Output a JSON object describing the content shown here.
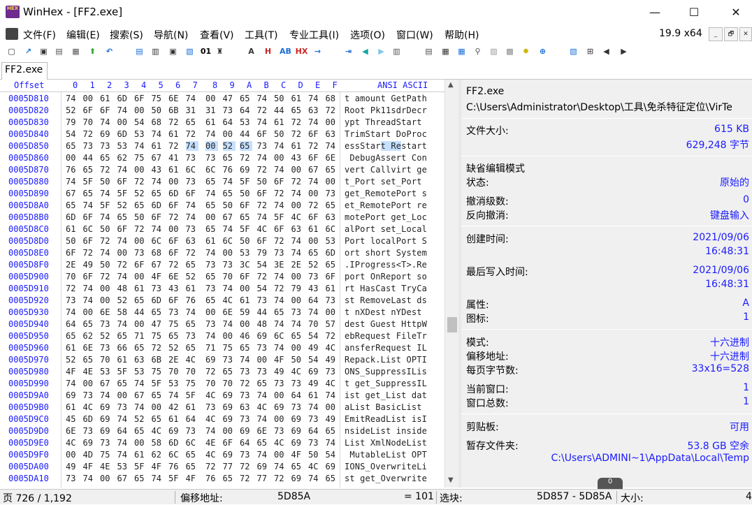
{
  "window": {
    "title": "WinHex - [FF2.exe]",
    "logo_text": "HEX",
    "minimize": "—",
    "maximize": "☐",
    "close": "✕"
  },
  "menu": {
    "items": [
      "文件(F)",
      "编辑(E)",
      "搜索(S)",
      "导航(N)",
      "查看(V)",
      "工具(T)",
      "专业工具(I)",
      "选项(O)",
      "窗口(W)",
      "帮助(H)"
    ],
    "version": "19.9 x64",
    "mdi": [
      "_",
      "🗗",
      "✕"
    ]
  },
  "toolbar": {
    "icons": [
      "new-file-icon",
      "open-icon",
      "save-icon",
      "print-icon",
      "properties-icon",
      "open-disk-icon",
      "undo-icon",
      "copy-icon",
      "paste-icon",
      "clipboard-icon",
      "copy-hex-icon",
      "binary-icon",
      "find-icon",
      "find-text-icon",
      "find-hex-icon",
      "replace-text-icon",
      "replace-hex-icon",
      "goto-offset-icon",
      "goto-sector-icon",
      "back-icon",
      "forward-icon",
      "disk-editor-icon",
      "ram-editor-icon",
      "hdd-icon",
      "calc-icon",
      "analyze-icon",
      "search-disk-icon",
      "hash-icon",
      "options-icon",
      "unk-icon",
      "sidebar-icon",
      "prev-icon",
      "next-icon",
      "help-book-icon"
    ]
  },
  "tab": {
    "label": "FF2.exe"
  },
  "hex": {
    "header": {
      "offset": "Offset",
      "cols": [
        "0",
        "1",
        "2",
        "3",
        "4",
        "5",
        "6",
        "7",
        "8",
        "9",
        "A",
        "B",
        "C",
        "D",
        "E",
        "F"
      ],
      "ansi": "ANSI ASCII"
    },
    "rows": [
      {
        "off": "0005D810",
        "b": [
          "74",
          "00",
          "61",
          "6D",
          "6F",
          "75",
          "6E",
          "74",
          "00",
          "47",
          "65",
          "74",
          "50",
          "61",
          "74",
          "68"
        ],
        "a": "t amount GetPath"
      },
      {
        "off": "0005D820",
        "b": [
          "52",
          "6F",
          "6F",
          "74",
          "00",
          "50",
          "6B",
          "31",
          "31",
          "73",
          "64",
          "72",
          "44",
          "65",
          "63",
          "72"
        ],
        "a": "Root Pk11sdrDecr"
      },
      {
        "off": "0005D830",
        "b": [
          "79",
          "70",
          "74",
          "00",
          "54",
          "68",
          "72",
          "65",
          "61",
          "64",
          "53",
          "74",
          "61",
          "72",
          "74",
          "00"
        ],
        "a": "ypt ThreadStart "
      },
      {
        "off": "0005D840",
        "b": [
          "54",
          "72",
          "69",
          "6D",
          "53",
          "74",
          "61",
          "72",
          "74",
          "00",
          "44",
          "6F",
          "50",
          "72",
          "6F",
          "63"
        ],
        "a": "TrimStart DoProc"
      },
      {
        "off": "0005D850",
        "b": [
          "65",
          "73",
          "73",
          "53",
          "74",
          "61",
          "72",
          "74",
          "00",
          "52",
          "65",
          "73",
          "74",
          "61",
          "72",
          "74"
        ],
        "a": "essStart Restart"
      },
      {
        "off": "0005D860",
        "b": [
          "00",
          "44",
          "65",
          "62",
          "75",
          "67",
          "41",
          "73",
          "73",
          "65",
          "72",
          "74",
          "00",
          "43",
          "6F",
          "6E"
        ],
        "a": " DebugAssert Con"
      },
      {
        "off": "0005D870",
        "b": [
          "76",
          "65",
          "72",
          "74",
          "00",
          "43",
          "61",
          "6C",
          "6C",
          "76",
          "69",
          "72",
          "74",
          "00",
          "67",
          "65"
        ],
        "a": "vert Callvirt ge"
      },
      {
        "off": "0005D880",
        "b": [
          "74",
          "5F",
          "50",
          "6F",
          "72",
          "74",
          "00",
          "73",
          "65",
          "74",
          "5F",
          "50",
          "6F",
          "72",
          "74",
          "00"
        ],
        "a": "t_Port set_Port "
      },
      {
        "off": "0005D890",
        "b": [
          "67",
          "65",
          "74",
          "5F",
          "52",
          "65",
          "6D",
          "6F",
          "74",
          "65",
          "50",
          "6F",
          "72",
          "74",
          "00",
          "73"
        ],
        "a": "get_RemotePort s"
      },
      {
        "off": "0005D8A0",
        "b": [
          "65",
          "74",
          "5F",
          "52",
          "65",
          "6D",
          "6F",
          "74",
          "65",
          "50",
          "6F",
          "72",
          "74",
          "00",
          "72",
          "65"
        ],
        "a": "et_RemotePort re"
      },
      {
        "off": "0005D8B0",
        "b": [
          "6D",
          "6F",
          "74",
          "65",
          "50",
          "6F",
          "72",
          "74",
          "00",
          "67",
          "65",
          "74",
          "5F",
          "4C",
          "6F",
          "63"
        ],
        "a": "motePort get_Loc"
      },
      {
        "off": "0005D8C0",
        "b": [
          "61",
          "6C",
          "50",
          "6F",
          "72",
          "74",
          "00",
          "73",
          "65",
          "74",
          "5F",
          "4C",
          "6F",
          "63",
          "61",
          "6C"
        ],
        "a": "alPort set_Local"
      },
      {
        "off": "0005D8D0",
        "b": [
          "50",
          "6F",
          "72",
          "74",
          "00",
          "6C",
          "6F",
          "63",
          "61",
          "6C",
          "50",
          "6F",
          "72",
          "74",
          "00",
          "53"
        ],
        "a": "Port localPort S"
      },
      {
        "off": "0005D8E0",
        "b": [
          "6F",
          "72",
          "74",
          "00",
          "73",
          "68",
          "6F",
          "72",
          "74",
          "00",
          "53",
          "79",
          "73",
          "74",
          "65",
          "6D"
        ],
        "a": "ort short System"
      },
      {
        "off": "0005D8F0",
        "b": [
          "2E",
          "49",
          "50",
          "72",
          "6F",
          "67",
          "72",
          "65",
          "73",
          "73",
          "3C",
          "54",
          "3E",
          "2E",
          "52",
          "65"
        ],
        "a": ".IProgress<T>.Re"
      },
      {
        "off": "0005D900",
        "b": [
          "70",
          "6F",
          "72",
          "74",
          "00",
          "4F",
          "6E",
          "52",
          "65",
          "70",
          "6F",
          "72",
          "74",
          "00",
          "73",
          "6F"
        ],
        "a": "port OnReport so"
      },
      {
        "off": "0005D910",
        "b": [
          "72",
          "74",
          "00",
          "48",
          "61",
          "73",
          "43",
          "61",
          "73",
          "74",
          "00",
          "54",
          "72",
          "79",
          "43",
          "61"
        ],
        "a": "rt HasCast TryCa"
      },
      {
        "off": "0005D920",
        "b": [
          "73",
          "74",
          "00",
          "52",
          "65",
          "6D",
          "6F",
          "76",
          "65",
          "4C",
          "61",
          "73",
          "74",
          "00",
          "64",
          "73"
        ],
        "a": "st RemoveLast ds"
      },
      {
        "off": "0005D930",
        "b": [
          "74",
          "00",
          "6E",
          "58",
          "44",
          "65",
          "73",
          "74",
          "00",
          "6E",
          "59",
          "44",
          "65",
          "73",
          "74",
          "00"
        ],
        "a": "t nXDest nYDest "
      },
      {
        "off": "0005D940",
        "b": [
          "64",
          "65",
          "73",
          "74",
          "00",
          "47",
          "75",
          "65",
          "73",
          "74",
          "00",
          "48",
          "74",
          "74",
          "70",
          "57"
        ],
        "a": "dest Guest HttpW"
      },
      {
        "off": "0005D950",
        "b": [
          "65",
          "62",
          "52",
          "65",
          "71",
          "75",
          "65",
          "73",
          "74",
          "00",
          "46",
          "69",
          "6C",
          "65",
          "54",
          "72"
        ],
        "a": "ebRequest FileTr"
      },
      {
        "off": "0005D960",
        "b": [
          "61",
          "6E",
          "73",
          "66",
          "65",
          "72",
          "52",
          "65",
          "71",
          "75",
          "65",
          "73",
          "74",
          "00",
          "49",
          "4C"
        ],
        "a": "ansferRequest IL"
      },
      {
        "off": "0005D970",
        "b": [
          "52",
          "65",
          "70",
          "61",
          "63",
          "6B",
          "2E",
          "4C",
          "69",
          "73",
          "74",
          "00",
          "4F",
          "50",
          "54",
          "49"
        ],
        "a": "Repack.List OPTI"
      },
      {
        "off": "0005D980",
        "b": [
          "4F",
          "4E",
          "53",
          "5F",
          "53",
          "75",
          "70",
          "70",
          "72",
          "65",
          "73",
          "73",
          "49",
          "4C",
          "69",
          "73"
        ],
        "a": "ONS_SuppressILis"
      },
      {
        "off": "0005D990",
        "b": [
          "74",
          "00",
          "67",
          "65",
          "74",
          "5F",
          "53",
          "75",
          "70",
          "70",
          "72",
          "65",
          "73",
          "73",
          "49",
          "4C"
        ],
        "a": "t get_SuppressIL"
      },
      {
        "off": "0005D9A0",
        "b": [
          "69",
          "73",
          "74",
          "00",
          "67",
          "65",
          "74",
          "5F",
          "4C",
          "69",
          "73",
          "74",
          "00",
          "64",
          "61",
          "74"
        ],
        "a": "ist get_List dat"
      },
      {
        "off": "0005D9B0",
        "b": [
          "61",
          "4C",
          "69",
          "73",
          "74",
          "00",
          "42",
          "61",
          "73",
          "69",
          "63",
          "4C",
          "69",
          "73",
          "74",
          "00"
        ],
        "a": "aList BasicList "
      },
      {
        "off": "0005D9C0",
        "b": [
          "45",
          "6D",
          "69",
          "74",
          "52",
          "65",
          "61",
          "64",
          "4C",
          "69",
          "73",
          "74",
          "00",
          "69",
          "73",
          "49"
        ],
        "a": "EmitReadList isI"
      },
      {
        "off": "0005D9D0",
        "b": [
          "6E",
          "73",
          "69",
          "64",
          "65",
          "4C",
          "69",
          "73",
          "74",
          "00",
          "69",
          "6E",
          "73",
          "69",
          "64",
          "65"
        ],
        "a": "nsideList inside"
      },
      {
        "off": "0005D9E0",
        "b": [
          "4C",
          "69",
          "73",
          "74",
          "00",
          "58",
          "6D",
          "6C",
          "4E",
          "6F",
          "64",
          "65",
          "4C",
          "69",
          "73",
          "74"
        ],
        "a": "List XmlNodeList"
      },
      {
        "off": "0005D9F0",
        "b": [
          "00",
          "4D",
          "75",
          "74",
          "61",
          "62",
          "6C",
          "65",
          "4C",
          "69",
          "73",
          "74",
          "00",
          "4F",
          "50",
          "54"
        ],
        "a": " MutableList OPT"
      },
      {
        "off": "0005DA00",
        "b": [
          "49",
          "4F",
          "4E",
          "53",
          "5F",
          "4F",
          "76",
          "65",
          "72",
          "77",
          "72",
          "69",
          "74",
          "65",
          "4C",
          "69"
        ],
        "a": "IONS_OverwriteLi"
      },
      {
        "off": "0005DA10",
        "b": [
          "73",
          "74",
          "00",
          "67",
          "65",
          "74",
          "5F",
          "4F",
          "76",
          "65",
          "72",
          "77",
          "72",
          "69",
          "74",
          "65"
        ],
        "a": "st get_Overwrite"
      }
    ],
    "selection": {
      "row": 4,
      "from_col": 7,
      "to_col": 10
    }
  },
  "info": {
    "file_name": "FF2.exe",
    "file_path": "C:\\Users\\Administrator\\Desktop\\工具\\免杀特征定位\\VirTe",
    "file_size_label": "文件大小:",
    "file_size_kb": "615 KB",
    "file_size_bytes": "629,248 字节",
    "edit_mode_label": "缺省编辑模式",
    "state_label": "状态:",
    "state_value": "原始的",
    "undo_level_label": "撤消级数:",
    "undo_level_value": "0",
    "redo_label": "反向撤消:",
    "redo_value": "键盘输入",
    "created_label": "创建时间:",
    "created_date": "2021/09/06",
    "created_time": "16:48:31",
    "modified_label": "最后写入时间:",
    "modified_date": "2021/09/06",
    "modified_time": "16:48:31",
    "attr_label": "属性:",
    "attr_value": "A",
    "icon_label": "图标:",
    "icon_value": "1",
    "mode_label": "模式:",
    "mode_value": "十六进制",
    "offset_label": "偏移地址:",
    "offset_value": "十六进制",
    "bytes_per_page_label": "每页字节数:",
    "bytes_per_page_value": "33x16=528",
    "cur_window_label": "当前窗口:",
    "cur_window_value": "1",
    "total_windows_label": "窗口总数:",
    "total_windows_value": "1",
    "clipboard_label": "剪贴板:",
    "clipboard_value": "可用",
    "temp_label": "暂存文件夹:",
    "temp_free": "53.8 GB 空余",
    "temp_path": "C:\\Users\\ADMINI~1\\AppData\\Local\\Temp"
  },
  "status": {
    "page": "页 726 / 1,192",
    "offset_label": "偏移地址:",
    "offset_value": "5D85A",
    "value": "= 101",
    "block_label": "选块:",
    "block_value": "5D857 - 5D85A",
    "size_label": "大小:",
    "size_value": "4"
  },
  "bottom_tab": {
    "label": "0"
  }
}
